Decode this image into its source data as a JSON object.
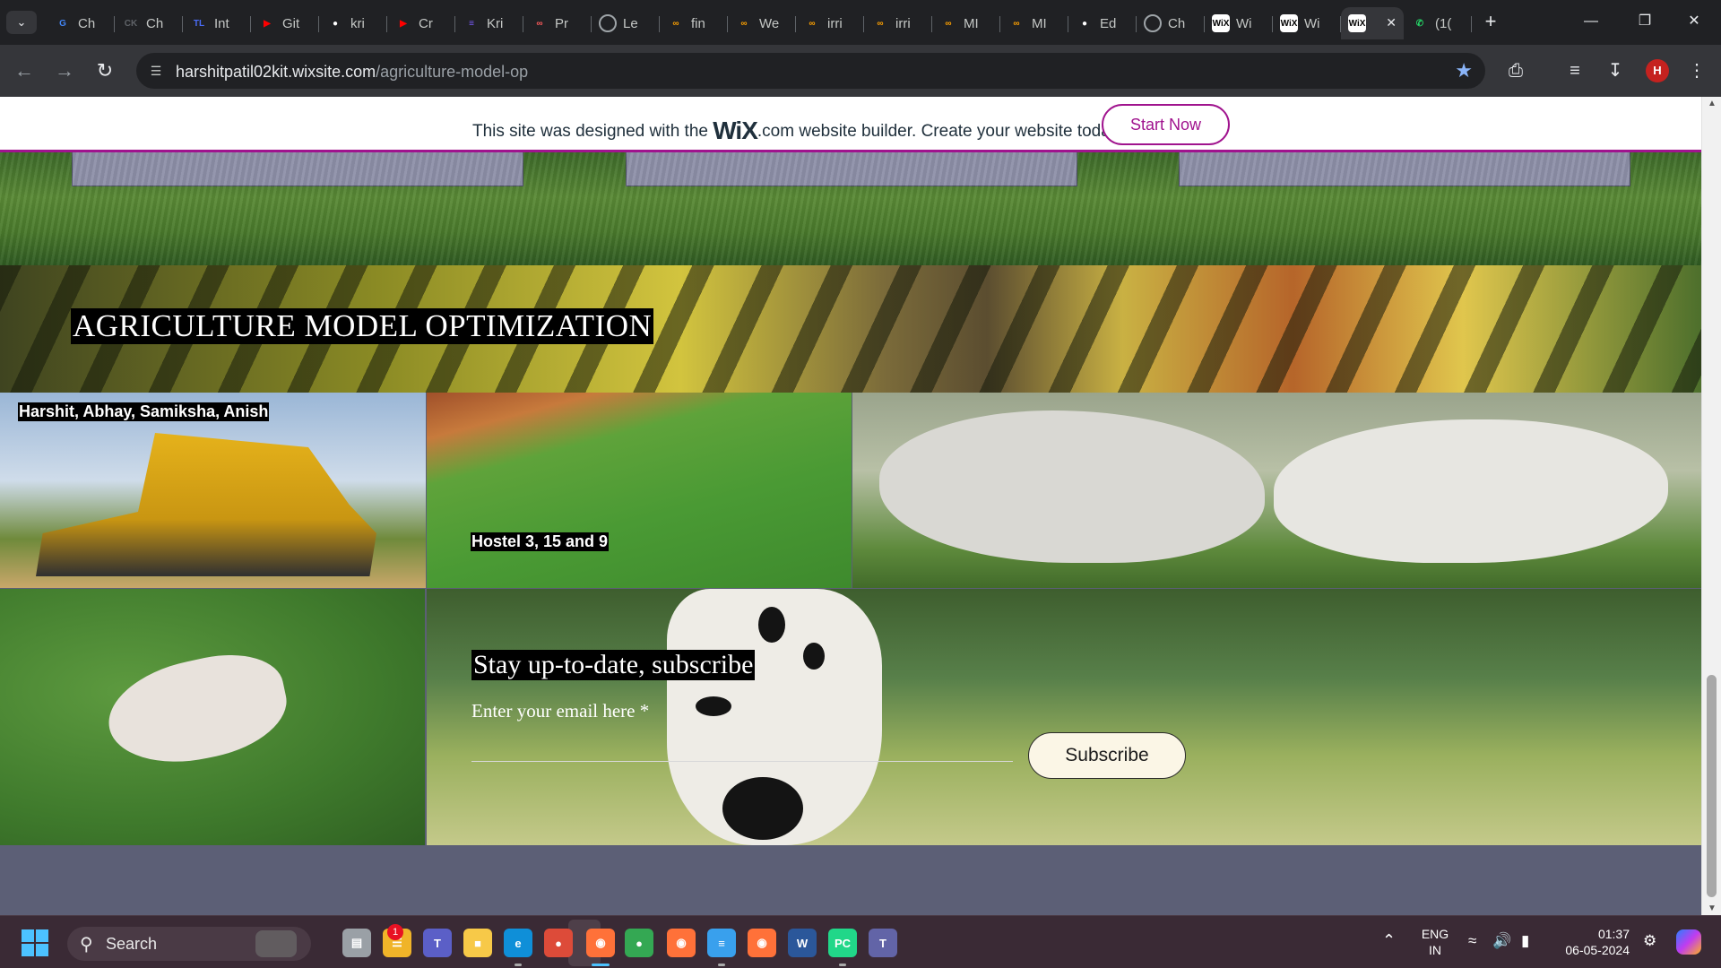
{
  "browser": {
    "tabs": [
      {
        "label": "Ch",
        "icon": "google-icon",
        "color": "#4285f4"
      },
      {
        "label": "Ch",
        "icon": "ck-icon",
        "color": "#5f6368"
      },
      {
        "label": "Int",
        "icon": "tl-icon",
        "color": "#4a6cf7"
      },
      {
        "label": "Git",
        "icon": "youtube-icon",
        "color": "#ff0000"
      },
      {
        "label": "kri",
        "icon": "github-icon",
        "color": "#ffffff"
      },
      {
        "label": "Cr",
        "icon": "youtube-icon",
        "color": "#ff0000"
      },
      {
        "label": "Kri",
        "icon": "list-icon",
        "color": "#7b5cff"
      },
      {
        "label": "Pr",
        "icon": "loop-icon",
        "color": "#ff5b5b"
      },
      {
        "label": "Le",
        "icon": "openai-icon",
        "color": "#9ea4a8"
      },
      {
        "label": "fin",
        "icon": "loop-icon",
        "color": "#ffa200"
      },
      {
        "label": "We",
        "icon": "loop-icon",
        "color": "#ffa200"
      },
      {
        "label": "irri",
        "icon": "loop-icon",
        "color": "#ffa200"
      },
      {
        "label": "irri",
        "icon": "loop-icon",
        "color": "#ffa200"
      },
      {
        "label": "MI",
        "icon": "loop-icon",
        "color": "#ffa200"
      },
      {
        "label": "MI",
        "icon": "loop-icon",
        "color": "#ffa200"
      },
      {
        "label": "Ed",
        "icon": "github-icon",
        "color": "#ffffff"
      },
      {
        "label": "Ch",
        "icon": "openai-icon",
        "color": "#9ea4a8"
      },
      {
        "label": "Wi",
        "icon": "wix-icon",
        "color": "#ffffff"
      },
      {
        "label": "Wi",
        "icon": "wix-icon",
        "color": "#ffffff"
      },
      {
        "label": "",
        "icon": "wix-icon",
        "color": "#ffffff",
        "active": true
      },
      {
        "label": "(1(",
        "icon": "whatsapp-icon",
        "color": "#25d366"
      }
    ],
    "new_tab": "+",
    "url_host": "harshitpatil02kit.wixsite.com",
    "url_path": "/agriculture-model-op",
    "profile_initial": "H"
  },
  "wix_banner": {
    "prefix": "This site was designed with the",
    "logo": "WiX",
    "suffix": ".com website builder. Create your website today.",
    "cta": "Start Now",
    "accent": "#a0138e"
  },
  "page": {
    "title": "AGRICULTURE MODEL OPTIMIZATION",
    "names": "Harshit, Abhay, Samiksha, Anish",
    "location": "Hostel 3, 15 and 9",
    "subscribe_heading": "Stay up-to-date, subscribe",
    "email_label": "Enter your email here *",
    "subscribe_button": "Subscribe"
  },
  "taskbar": {
    "search_label": "Search",
    "badge_count": "1",
    "apps": [
      "file-explorer-icon",
      "task-view-icon",
      "widgets-icon",
      "teams-icon",
      "folder-icon",
      "edge-icon",
      "chrome-icon",
      "firefox-icon",
      "chrome-icon",
      "notepad-icon",
      "chrome-icon",
      "word-icon",
      "pycharm-icon",
      "teams-new-icon"
    ],
    "lang_top": "ENG",
    "lang_bottom": "IN",
    "time": "01:37",
    "date": "06-05-2024"
  }
}
